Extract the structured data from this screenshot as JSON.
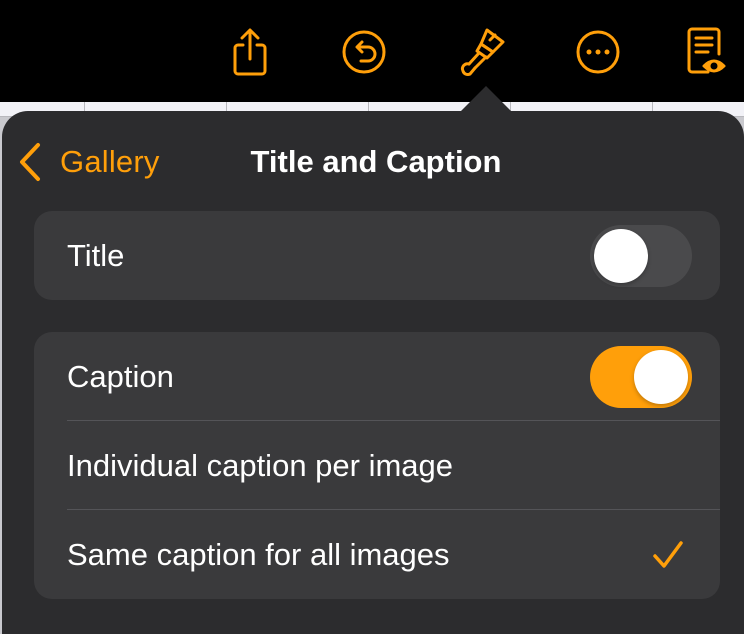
{
  "toolbar": {
    "icons": [
      {
        "name": "share-icon",
        "color": "#ff9f0a"
      },
      {
        "name": "undo-icon",
        "color": "#ff9f0a"
      },
      {
        "name": "format-paintbrush-icon",
        "color": "#ff9f0a"
      },
      {
        "name": "more-icon",
        "color": "#ff9f0a"
      },
      {
        "name": "reading-view-icon",
        "color": "#ff9f0a"
      }
    ]
  },
  "popover": {
    "nav": {
      "back_label": "Gallery",
      "title": "Title and Caption"
    },
    "title_section": {
      "label": "Title",
      "toggle_on": false
    },
    "caption_section": {
      "label": "Caption",
      "toggle_on": true,
      "options": [
        {
          "label": "Individual caption per image",
          "selected": false
        },
        {
          "label": "Same caption for all images",
          "selected": true
        }
      ]
    }
  },
  "colors": {
    "accent": "#ff9f0a",
    "popover_bg": "#2c2c2e",
    "cell_bg": "#3a3a3c",
    "text": "#ffffff"
  }
}
